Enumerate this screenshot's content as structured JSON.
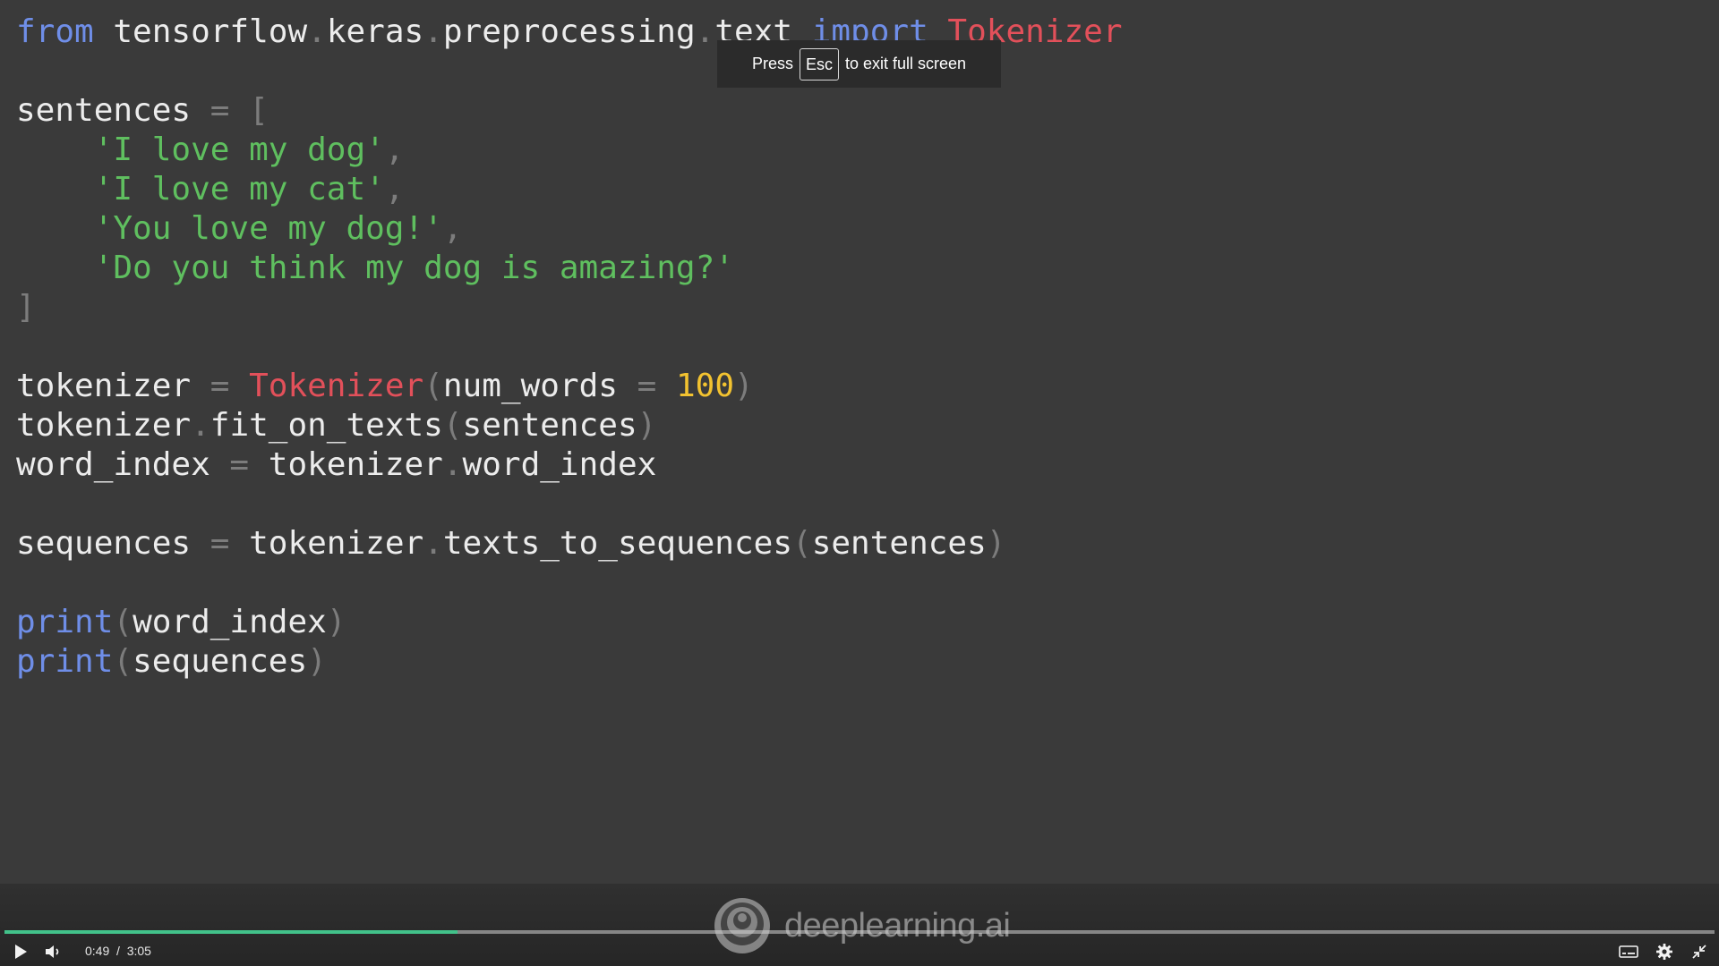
{
  "code_lines": [
    [
      [
        "kw",
        "from"
      ],
      [
        "id",
        " tensorflow"
      ],
      [
        "punc",
        "."
      ],
      [
        "id",
        "keras"
      ],
      [
        "punc",
        "."
      ],
      [
        "id",
        "preprocessing"
      ],
      [
        "punc",
        "."
      ],
      [
        "id",
        "text "
      ],
      [
        "kw",
        "import"
      ],
      [
        "cls",
        " Tokenizer"
      ]
    ],
    [],
    [
      [
        "id",
        "sentences "
      ],
      [
        "punc",
        "= ["
      ]
    ],
    [
      [
        "id",
        "    "
      ],
      [
        "str",
        "'I love my dog'"
      ],
      [
        "punc",
        ","
      ]
    ],
    [
      [
        "id",
        "    "
      ],
      [
        "str",
        "'I love my cat'"
      ],
      [
        "punc",
        ","
      ]
    ],
    [
      [
        "id",
        "    "
      ],
      [
        "str",
        "'You love my dog!'"
      ],
      [
        "punc",
        ","
      ]
    ],
    [
      [
        "id",
        "    "
      ],
      [
        "str",
        "'Do you think my dog is amazing?'"
      ]
    ],
    [
      [
        "punc",
        "]"
      ]
    ],
    [],
    [
      [
        "id",
        "tokenizer "
      ],
      [
        "punc",
        "= "
      ],
      [
        "cls",
        "Tokenizer"
      ],
      [
        "punc",
        "("
      ],
      [
        "id",
        "num_words "
      ],
      [
        "punc",
        "= "
      ],
      [
        "num",
        "100"
      ],
      [
        "punc",
        ")"
      ]
    ],
    [
      [
        "id",
        "tokenizer"
      ],
      [
        "punc",
        "."
      ],
      [
        "id",
        "fit_on_texts"
      ],
      [
        "punc",
        "("
      ],
      [
        "id",
        "sentences"
      ],
      [
        "punc",
        ")"
      ]
    ],
    [
      [
        "id",
        "word_index "
      ],
      [
        "punc",
        "= "
      ],
      [
        "id",
        "tokenizer"
      ],
      [
        "punc",
        "."
      ],
      [
        "id",
        "word_index"
      ]
    ],
    [],
    [
      [
        "id",
        "sequences "
      ],
      [
        "punc",
        "= "
      ],
      [
        "id",
        "tokenizer"
      ],
      [
        "punc",
        "."
      ],
      [
        "id",
        "texts_to_sequences"
      ],
      [
        "punc",
        "("
      ],
      [
        "id",
        "sentences"
      ],
      [
        "punc",
        ")"
      ]
    ],
    [],
    [
      [
        "kw",
        "print"
      ],
      [
        "punc",
        "("
      ],
      [
        "id",
        "word_index"
      ],
      [
        "punc",
        ")"
      ]
    ],
    [
      [
        "kw",
        "print"
      ],
      [
        "punc",
        "("
      ],
      [
        "id",
        "sequences"
      ],
      [
        "punc",
        ")"
      ]
    ]
  ],
  "fullscreen_notice": {
    "press": "Press",
    "key": "Esc",
    "rest": "to exit full screen"
  },
  "branding": {
    "text": "deeplearning.ai",
    "icon": "deeplearning-logo-icon"
  },
  "player": {
    "current_time": "0:49",
    "separator": "/",
    "duration": "3:05",
    "progress": 0.265,
    "progress_color": "#42c28a",
    "buttons": {
      "play": "play-icon",
      "volume": "volume-icon",
      "captions": "captions-icon",
      "settings": "gear-icon",
      "exit_fullscreen": "exit-fullscreen-icon"
    }
  }
}
